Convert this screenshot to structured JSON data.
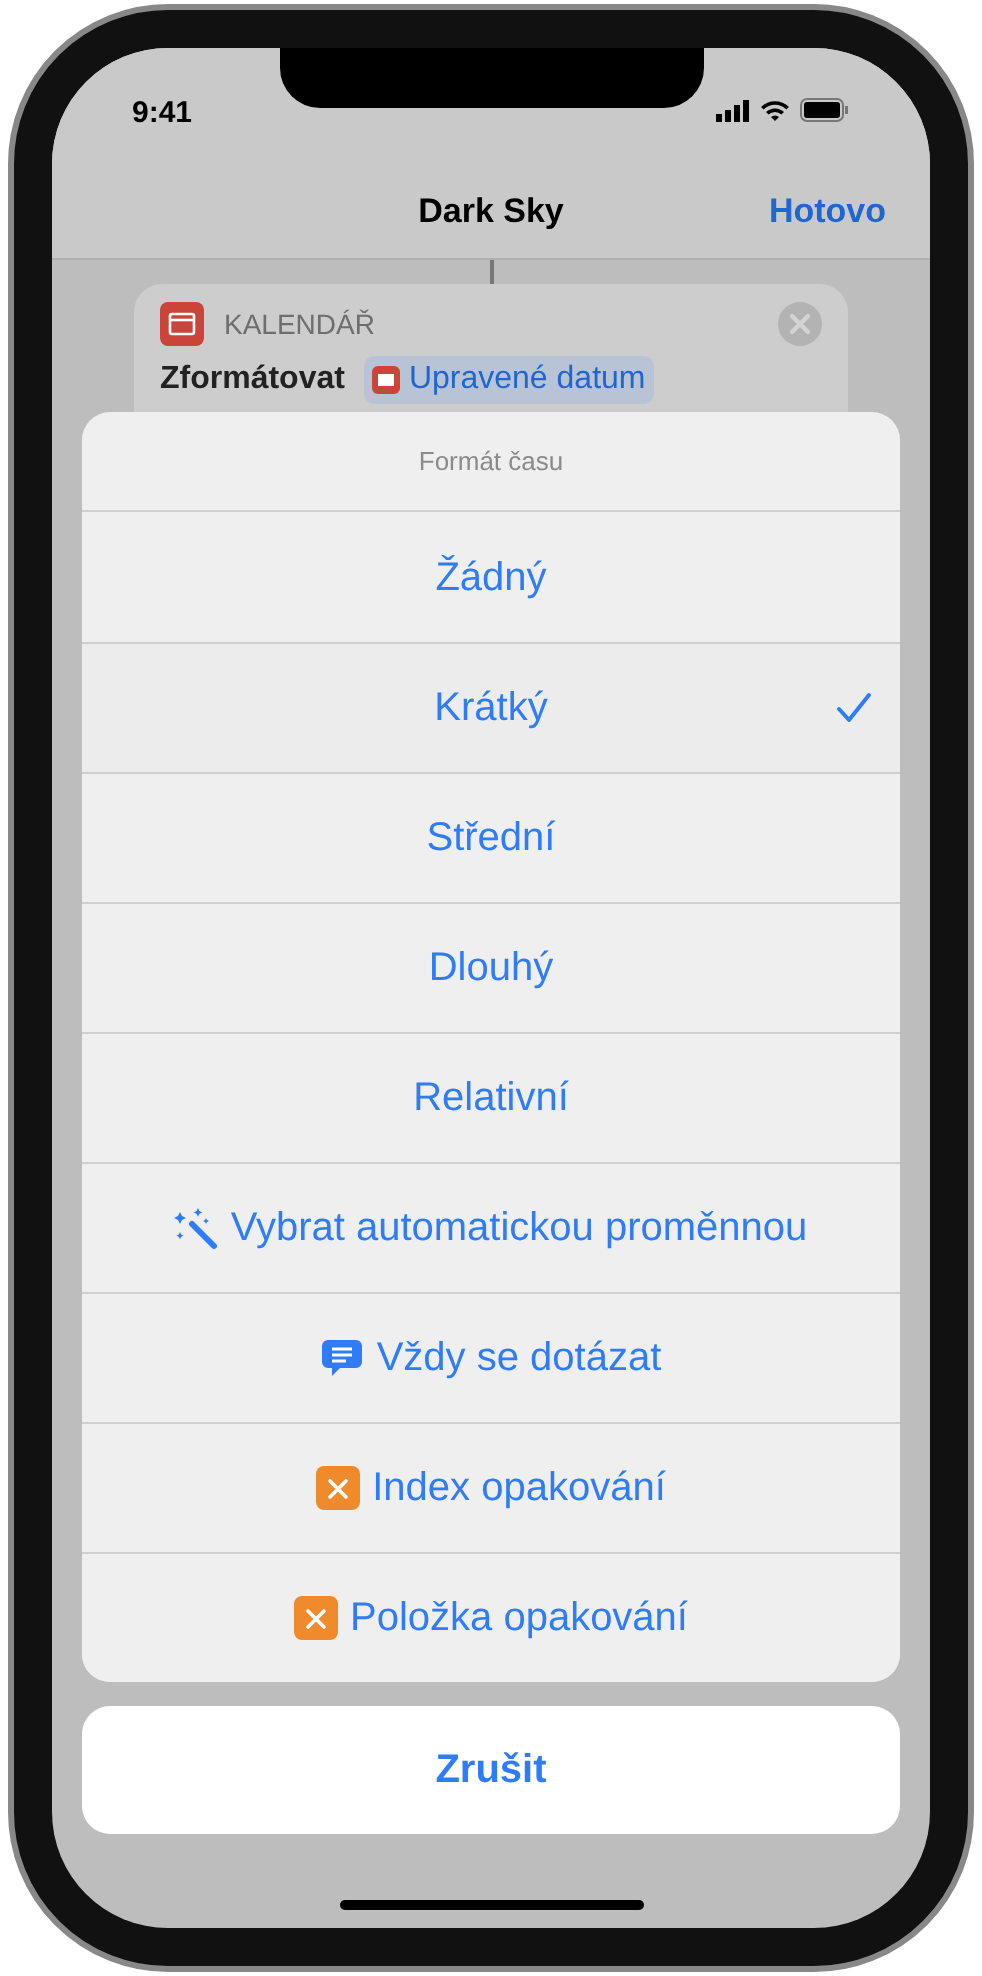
{
  "status_bar": {
    "time": "9:41"
  },
  "nav": {
    "title": "Dark Sky",
    "done": "Hotovo"
  },
  "card": {
    "category": "KALENDÁŘ",
    "action": "Zformátovat",
    "variable": "Upravené datum"
  },
  "sheet": {
    "title": "Formát času",
    "options": [
      {
        "kind": "text",
        "label": "Žádný",
        "selected": false
      },
      {
        "kind": "text",
        "label": "Krátký",
        "selected": true
      },
      {
        "kind": "text",
        "label": "Střední",
        "selected": false
      },
      {
        "kind": "text",
        "label": "Dlouhý",
        "selected": false
      },
      {
        "kind": "text",
        "label": "Relativní",
        "selected": false
      },
      {
        "kind": "wand",
        "label": "Vybrat automatickou proměnnou",
        "selected": false
      },
      {
        "kind": "ask",
        "label": "Vždy se dotázat",
        "selected": false
      },
      {
        "kind": "variable",
        "label": "Index opakování",
        "selected": false
      },
      {
        "kind": "variable",
        "label": "Položka opakování",
        "selected": false
      }
    ]
  },
  "cancel": "Zrušit"
}
